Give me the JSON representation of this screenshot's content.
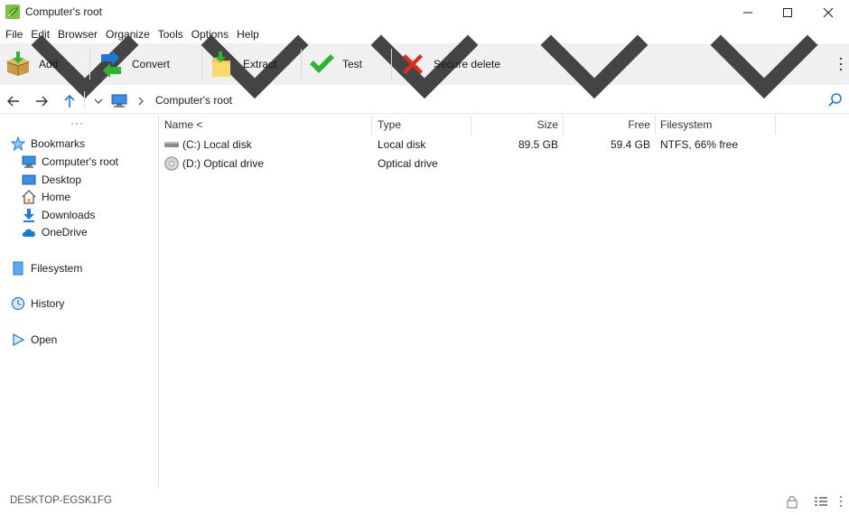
{
  "window": {
    "title": "Computer's root",
    "controls": {
      "minimize": "─",
      "maximize": "☐",
      "close": "✕"
    }
  },
  "menu": [
    "File",
    "Edit",
    "Browser",
    "Organize",
    "Tools",
    "Options",
    "Help"
  ],
  "toolbar": {
    "buttons": [
      {
        "label": "Add",
        "icon": "add-box-icon"
      },
      {
        "label": "Convert",
        "icon": "convert-arrows-icon"
      },
      {
        "label": "Extract",
        "icon": "extract-folder-icon"
      },
      {
        "label": "Test",
        "icon": "checkmark-icon"
      },
      {
        "label": "Secure delete",
        "icon": "red-x-icon"
      }
    ]
  },
  "address": {
    "path": "Computer's root"
  },
  "sidebar": {
    "more": "···",
    "bookmarks_label": "Bookmarks",
    "bookmarks": [
      "Computer's root",
      "Desktop",
      "Home",
      "Downloads",
      "OneDrive"
    ],
    "filesystem_label": "Filesystem",
    "history_label": "History",
    "open_label": "Open"
  },
  "list": {
    "columns": [
      "Name <",
      "Type",
      "Size",
      "Free",
      "Filesystem"
    ],
    "rows": [
      {
        "name": "(C:) Local disk",
        "type": "Local disk",
        "size": "89.5 GB",
        "free": "59.4 GB",
        "filesystem": "NTFS, 66% free",
        "icon": "hard-disk-icon"
      },
      {
        "name": "(D:) Optical drive",
        "type": "Optical drive",
        "size": "",
        "free": "",
        "filesystem": "",
        "icon": "optical-disc-icon"
      }
    ]
  },
  "status": {
    "computer": "DESKTOP-EGSK1FG"
  },
  "colors": {
    "toolbar_bg": "#f0f0f0",
    "accent_blue": "#1e78d7",
    "green": "#2db52d",
    "red": "#e02b20"
  }
}
